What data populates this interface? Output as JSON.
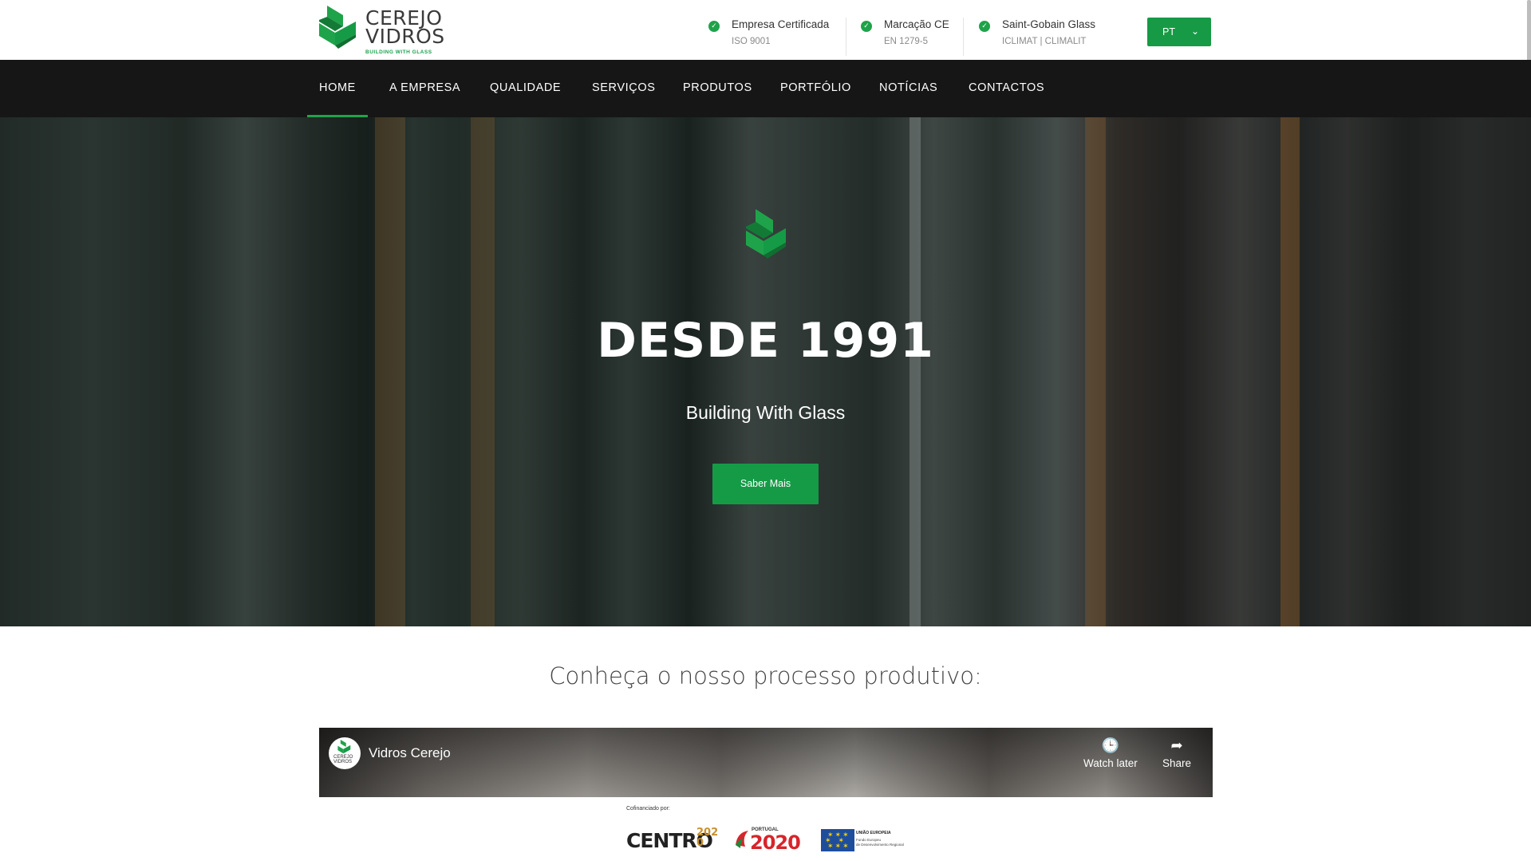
{
  "brand": {
    "line1": "CEREJO",
    "line2": "VIDROS",
    "tagline": "BUILDING WITH GLASS",
    "accent": "#1fa34a"
  },
  "certifications": [
    {
      "title": "Empresa Certificada",
      "subtitle": "ISO 9001"
    },
    {
      "title": "Marcação CE",
      "subtitle": "EN 1279-5"
    },
    {
      "title": "Saint-Gobain Glass",
      "subtitle": "ICLIMAT | CLIMALIT"
    }
  ],
  "language": {
    "selected": "PT",
    "chevron": "⌄"
  },
  "nav": {
    "items": [
      {
        "label": "HOME",
        "active": true
      },
      {
        "label": "A EMPRESA"
      },
      {
        "label": "QUALIDADE"
      },
      {
        "label": "SERVIÇOS"
      },
      {
        "label": "PRODUTOS"
      },
      {
        "label": "PORTFÓLIO"
      },
      {
        "label": "NOTÍCIAS"
      },
      {
        "label": "CONTACTOS"
      }
    ]
  },
  "hero": {
    "title": "DESDE 1991",
    "subtitle": "Building With Glass",
    "button": "Saber Mais"
  },
  "process": {
    "title": "Conheça o nosso processo produtivo:"
  },
  "video": {
    "channel_title": "Vidros Cerejo",
    "avatar_text": "CEREJO VIDROS",
    "watch_later": "Watch later",
    "share": "Share",
    "watch_later_icon": "clock-icon",
    "share_icon": "share-arrow-icon"
  },
  "funding": {
    "label": "Cofinanciado por:",
    "logos": [
      "CENTRO2020",
      "PORTUGAL 2020",
      "UNIÃO EUROPEIA"
    ],
    "centro": "CENTRO",
    "centro_year": "2020",
    "portugal_word": "PORTUGAL",
    "portugal_year": "2020",
    "eu_title": "UNIÃO EUROPEIA",
    "eu_sub1": "Fundo Europeu",
    "eu_sub2": "de Desenvolvimento Regional"
  }
}
